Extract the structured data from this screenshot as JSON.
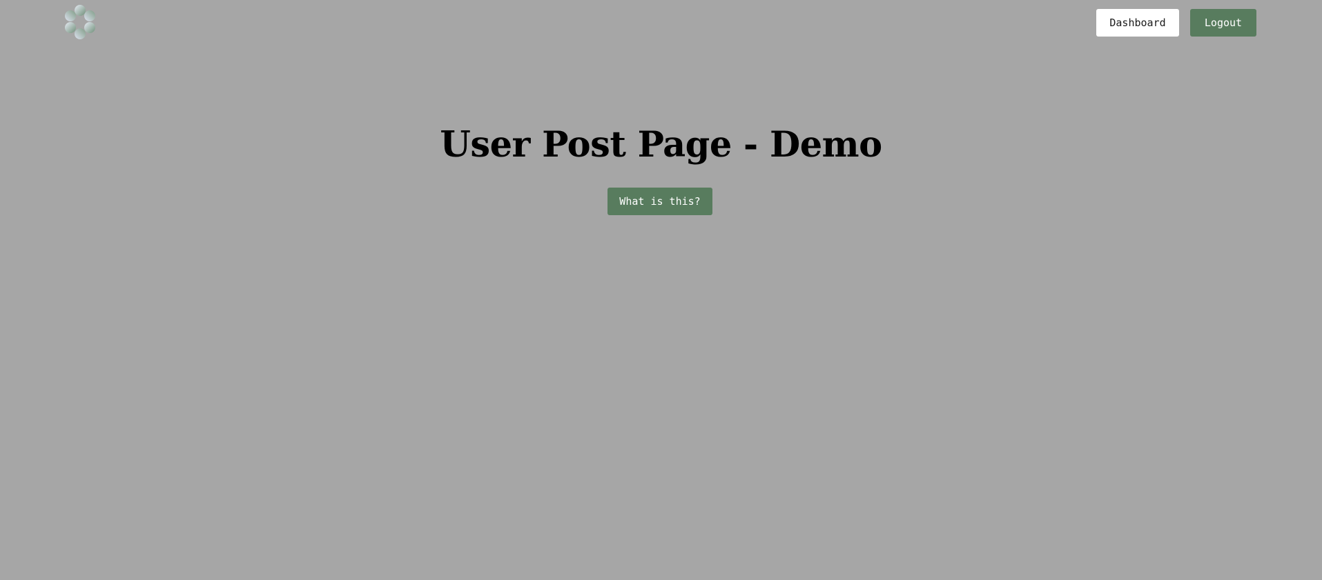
{
  "header": {
    "logo_icon": "flower-circles-logo-icon",
    "nav": {
      "dashboard_label": "Dashboard",
      "logout_label": "Logout"
    }
  },
  "main": {
    "title": "User Post Page - Demo",
    "info_button_label": "What is this?"
  },
  "colors": {
    "background": "#a6a6a6",
    "accent": "#587c5e",
    "secondary_button": "#ffffff",
    "title_text": "#000000"
  }
}
